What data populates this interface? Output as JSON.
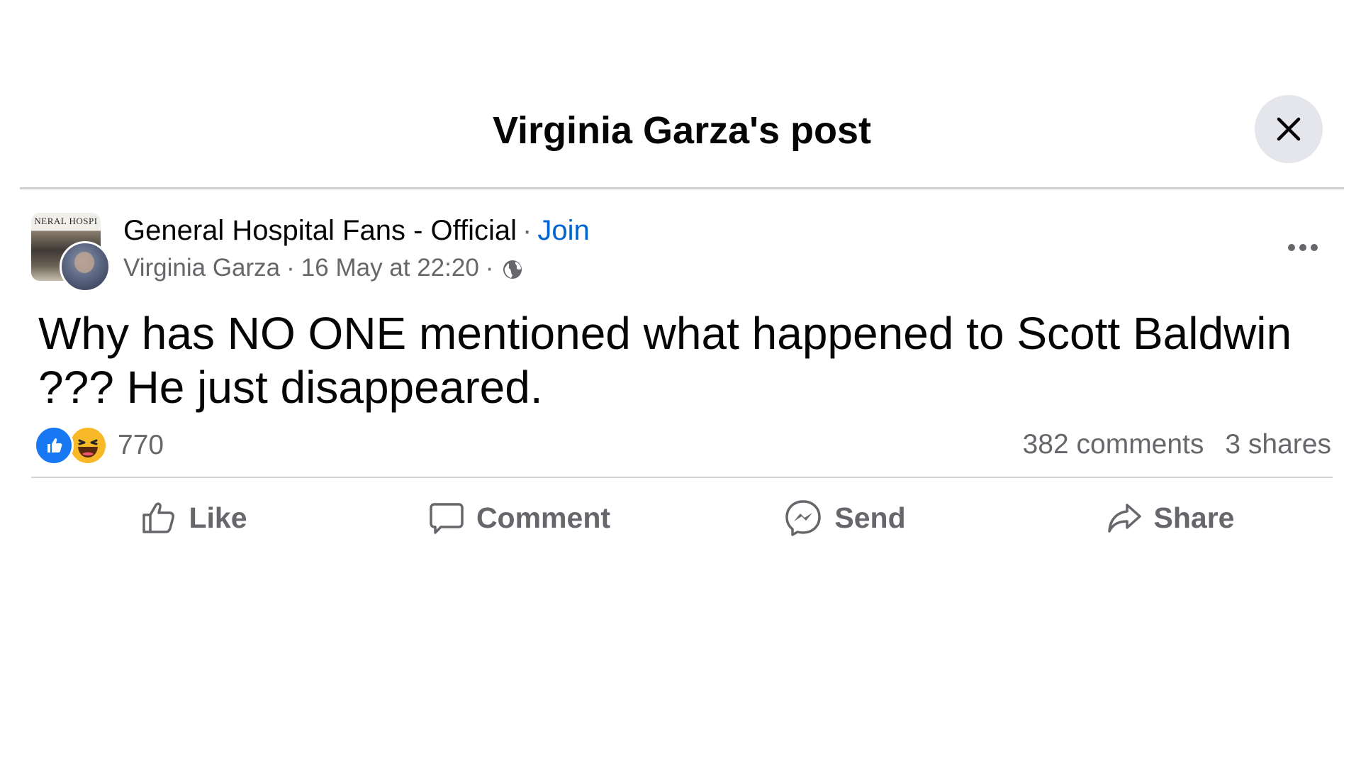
{
  "dialog": {
    "title": "Virginia Garza's post",
    "close_icon": "close-icon"
  },
  "post": {
    "group_name": "General Hospital Fans - Official",
    "separator": "·",
    "join_label": "Join",
    "group_avatar_text": "NERAL HOSPI",
    "author": "Virginia Garza",
    "timestamp": "16 May at 22:20",
    "privacy_icon": "globe-icon",
    "more_icon": "more-horizontal-icon",
    "text": "Why has NO ONE mentioned what happened to Scott Baldwin ??? He just disappeared."
  },
  "stats": {
    "reaction_icons": [
      "like-reaction-icon",
      "haha-reaction-icon"
    ],
    "reaction_count": "770",
    "comments": "382 comments",
    "shares": "3 shares"
  },
  "actions": {
    "like": "Like",
    "comment": "Comment",
    "send": "Send",
    "share": "Share"
  },
  "colors": {
    "link_blue": "#0064d1",
    "like_blue": "#1877f2",
    "haha_yellow": "#f7b928",
    "secondary_text": "#65676b",
    "divider": "#ced0d4",
    "close_bg": "#e4e6eb"
  }
}
